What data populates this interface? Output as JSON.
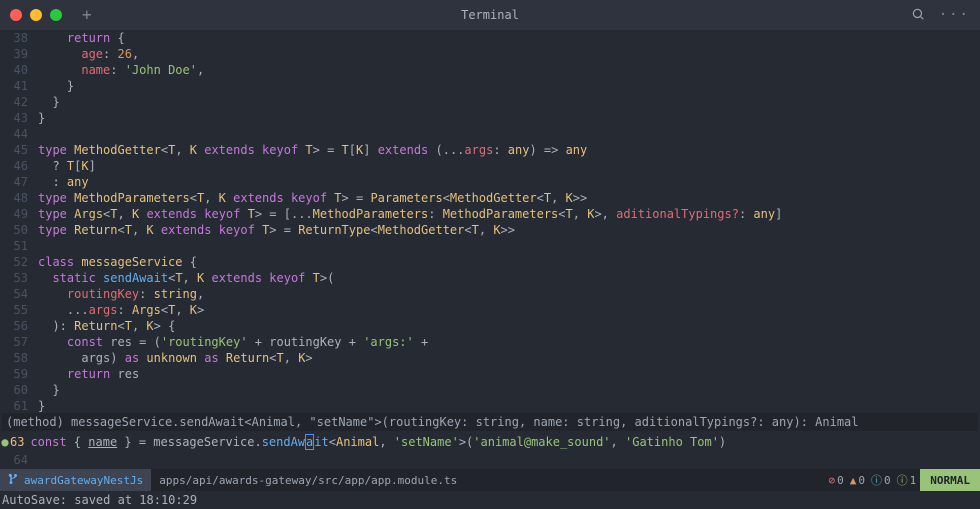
{
  "titlebar": {
    "title": "Terminal"
  },
  "code": {
    "lines": [
      {
        "n": 38,
        "i": 2,
        "t": [
          {
            "c": "kw",
            "s": "return"
          },
          {
            "c": "punc",
            "s": " {"
          }
        ]
      },
      {
        "n": 39,
        "i": 3,
        "t": [
          {
            "c": "prop",
            "s": "age"
          },
          {
            "c": "punc",
            "s": ": "
          },
          {
            "c": "num",
            "s": "26"
          },
          {
            "c": "punc",
            "s": ","
          }
        ]
      },
      {
        "n": 40,
        "i": 3,
        "t": [
          {
            "c": "prop",
            "s": "name"
          },
          {
            "c": "punc",
            "s": ": "
          },
          {
            "c": "str",
            "s": "'John Doe'"
          },
          {
            "c": "punc",
            "s": ","
          }
        ]
      },
      {
        "n": 41,
        "i": 2,
        "t": [
          {
            "c": "punc",
            "s": "}"
          }
        ]
      },
      {
        "n": 42,
        "i": 1,
        "t": [
          {
            "c": "punc",
            "s": "}"
          }
        ]
      },
      {
        "n": 43,
        "i": 0,
        "t": [
          {
            "c": "punc",
            "s": "}"
          }
        ]
      },
      {
        "n": 44,
        "i": 0,
        "t": []
      },
      {
        "n": 45,
        "i": 0,
        "t": [
          {
            "c": "kw",
            "s": "type"
          },
          {
            "c": "punc",
            "s": " "
          },
          {
            "c": "type",
            "s": "MethodGetter"
          },
          {
            "c": "punc",
            "s": "<"
          },
          {
            "c": "type",
            "s": "T"
          },
          {
            "c": "punc",
            "s": ", "
          },
          {
            "c": "type",
            "s": "K"
          },
          {
            "c": "punc",
            "s": " "
          },
          {
            "c": "kw",
            "s": "extends"
          },
          {
            "c": "punc",
            "s": " "
          },
          {
            "c": "kw",
            "s": "keyof"
          },
          {
            "c": "punc",
            "s": " "
          },
          {
            "c": "type",
            "s": "T"
          },
          {
            "c": "punc",
            "s": "> = "
          },
          {
            "c": "type",
            "s": "T"
          },
          {
            "c": "punc",
            "s": "["
          },
          {
            "c": "type",
            "s": "K"
          },
          {
            "c": "punc",
            "s": "] "
          },
          {
            "c": "kw",
            "s": "extends"
          },
          {
            "c": "punc",
            "s": " (..."
          },
          {
            "c": "param",
            "s": "args"
          },
          {
            "c": "punc",
            "s": ": "
          },
          {
            "c": "type",
            "s": "any"
          },
          {
            "c": "punc",
            "s": ") => "
          },
          {
            "c": "type",
            "s": "any"
          }
        ]
      },
      {
        "n": 46,
        "i": 1,
        "t": [
          {
            "c": "punc",
            "s": "? "
          },
          {
            "c": "type",
            "s": "T"
          },
          {
            "c": "punc",
            "s": "["
          },
          {
            "c": "type",
            "s": "K"
          },
          {
            "c": "punc",
            "s": "]"
          }
        ]
      },
      {
        "n": 47,
        "i": 1,
        "t": [
          {
            "c": "punc",
            "s": ": "
          },
          {
            "c": "type",
            "s": "any"
          }
        ]
      },
      {
        "n": 48,
        "i": 0,
        "t": [
          {
            "c": "kw",
            "s": "type"
          },
          {
            "c": "punc",
            "s": " "
          },
          {
            "c": "type",
            "s": "MethodParameters"
          },
          {
            "c": "punc",
            "s": "<"
          },
          {
            "c": "type",
            "s": "T"
          },
          {
            "c": "punc",
            "s": ", "
          },
          {
            "c": "type",
            "s": "K"
          },
          {
            "c": "punc",
            "s": " "
          },
          {
            "c": "kw",
            "s": "extends"
          },
          {
            "c": "punc",
            "s": " "
          },
          {
            "c": "kw",
            "s": "keyof"
          },
          {
            "c": "punc",
            "s": " "
          },
          {
            "c": "type",
            "s": "T"
          },
          {
            "c": "punc",
            "s": "> = "
          },
          {
            "c": "type",
            "s": "Parameters"
          },
          {
            "c": "punc",
            "s": "<"
          },
          {
            "c": "type",
            "s": "MethodGetter"
          },
          {
            "c": "punc",
            "s": "<"
          },
          {
            "c": "type",
            "s": "T"
          },
          {
            "c": "punc",
            "s": ", "
          },
          {
            "c": "type",
            "s": "K"
          },
          {
            "c": "punc",
            "s": ">>"
          }
        ]
      },
      {
        "n": 49,
        "i": 0,
        "t": [
          {
            "c": "kw",
            "s": "type"
          },
          {
            "c": "punc",
            "s": " "
          },
          {
            "c": "type",
            "s": "Args"
          },
          {
            "c": "punc",
            "s": "<"
          },
          {
            "c": "type",
            "s": "T"
          },
          {
            "c": "punc",
            "s": ", "
          },
          {
            "c": "type",
            "s": "K"
          },
          {
            "c": "punc",
            "s": " "
          },
          {
            "c": "kw",
            "s": "extends"
          },
          {
            "c": "punc",
            "s": " "
          },
          {
            "c": "kw",
            "s": "keyof"
          },
          {
            "c": "punc",
            "s": " "
          },
          {
            "c": "type",
            "s": "T"
          },
          {
            "c": "punc",
            "s": "> = [..."
          },
          {
            "c": "type",
            "s": "MethodParameters"
          },
          {
            "c": "punc",
            "s": ": "
          },
          {
            "c": "type",
            "s": "MethodParameters"
          },
          {
            "c": "punc",
            "s": "<"
          },
          {
            "c": "type",
            "s": "T"
          },
          {
            "c": "punc",
            "s": ", "
          },
          {
            "c": "type",
            "s": "K"
          },
          {
            "c": "punc",
            "s": ">, "
          },
          {
            "c": "param",
            "s": "aditionalTypings?"
          },
          {
            "c": "punc",
            "s": ": "
          },
          {
            "c": "type",
            "s": "any"
          },
          {
            "c": "punc",
            "s": "]"
          }
        ]
      },
      {
        "n": 50,
        "i": 0,
        "t": [
          {
            "c": "kw",
            "s": "type"
          },
          {
            "c": "punc",
            "s": " "
          },
          {
            "c": "type",
            "s": "Return"
          },
          {
            "c": "punc",
            "s": "<"
          },
          {
            "c": "type",
            "s": "T"
          },
          {
            "c": "punc",
            "s": ", "
          },
          {
            "c": "type",
            "s": "K"
          },
          {
            "c": "punc",
            "s": " "
          },
          {
            "c": "kw",
            "s": "extends"
          },
          {
            "c": "punc",
            "s": " "
          },
          {
            "c": "kw",
            "s": "keyof"
          },
          {
            "c": "punc",
            "s": " "
          },
          {
            "c": "type",
            "s": "T"
          },
          {
            "c": "punc",
            "s": "> = "
          },
          {
            "c": "type",
            "s": "ReturnType"
          },
          {
            "c": "punc",
            "s": "<"
          },
          {
            "c": "type",
            "s": "MethodGetter"
          },
          {
            "c": "punc",
            "s": "<"
          },
          {
            "c": "type",
            "s": "T"
          },
          {
            "c": "punc",
            "s": ", "
          },
          {
            "c": "type",
            "s": "K"
          },
          {
            "c": "punc",
            "s": ">>"
          }
        ]
      },
      {
        "n": 51,
        "i": 0,
        "t": []
      },
      {
        "n": 52,
        "i": 0,
        "t": [
          {
            "c": "kw",
            "s": "class"
          },
          {
            "c": "punc",
            "s": " "
          },
          {
            "c": "type",
            "s": "messageService"
          },
          {
            "c": "punc",
            "s": " {"
          }
        ]
      },
      {
        "n": 53,
        "i": 1,
        "t": [
          {
            "c": "kw",
            "s": "static"
          },
          {
            "c": "punc",
            "s": " "
          },
          {
            "c": "fn",
            "s": "sendAwait"
          },
          {
            "c": "punc",
            "s": "<"
          },
          {
            "c": "type",
            "s": "T"
          },
          {
            "c": "punc",
            "s": ", "
          },
          {
            "c": "type",
            "s": "K"
          },
          {
            "c": "punc",
            "s": " "
          },
          {
            "c": "kw",
            "s": "extends"
          },
          {
            "c": "punc",
            "s": " "
          },
          {
            "c": "kw",
            "s": "keyof"
          },
          {
            "c": "punc",
            "s": " "
          },
          {
            "c": "type",
            "s": "T"
          },
          {
            "c": "punc",
            "s": ">("
          }
        ]
      },
      {
        "n": 54,
        "i": 2,
        "t": [
          {
            "c": "param",
            "s": "routingKey"
          },
          {
            "c": "punc",
            "s": ": "
          },
          {
            "c": "type",
            "s": "string"
          },
          {
            "c": "punc",
            "s": ","
          }
        ]
      },
      {
        "n": 55,
        "i": 2,
        "t": [
          {
            "c": "punc",
            "s": "..."
          },
          {
            "c": "param",
            "s": "args"
          },
          {
            "c": "punc",
            "s": ": "
          },
          {
            "c": "type",
            "s": "Args"
          },
          {
            "c": "punc",
            "s": "<"
          },
          {
            "c": "type",
            "s": "T"
          },
          {
            "c": "punc",
            "s": ", "
          },
          {
            "c": "type",
            "s": "K"
          },
          {
            "c": "punc",
            "s": ">"
          }
        ]
      },
      {
        "n": 56,
        "i": 1,
        "t": [
          {
            "c": "punc",
            "s": "): "
          },
          {
            "c": "type",
            "s": "Return"
          },
          {
            "c": "punc",
            "s": "<"
          },
          {
            "c": "type",
            "s": "T"
          },
          {
            "c": "punc",
            "s": ", "
          },
          {
            "c": "type",
            "s": "K"
          },
          {
            "c": "punc",
            "s": "> {"
          }
        ]
      },
      {
        "n": 57,
        "i": 2,
        "t": [
          {
            "c": "kw",
            "s": "const"
          },
          {
            "c": "punc",
            "s": " "
          },
          {
            "c": "var",
            "s": "res"
          },
          {
            "c": "punc",
            "s": " = ("
          },
          {
            "c": "str",
            "s": "'routingKey'"
          },
          {
            "c": "punc",
            "s": " + "
          },
          {
            "c": "var",
            "s": "routingKey"
          },
          {
            "c": "punc",
            "s": " + "
          },
          {
            "c": "str",
            "s": "'args:'"
          },
          {
            "c": "punc",
            "s": " +"
          }
        ]
      },
      {
        "n": 58,
        "i": 3,
        "t": [
          {
            "c": "var",
            "s": "args"
          },
          {
            "c": "punc",
            "s": ") "
          },
          {
            "c": "kw",
            "s": "as"
          },
          {
            "c": "punc",
            "s": " "
          },
          {
            "c": "type",
            "s": "unknown"
          },
          {
            "c": "punc",
            "s": " "
          },
          {
            "c": "kw",
            "s": "as"
          },
          {
            "c": "punc",
            "s": " "
          },
          {
            "c": "type",
            "s": "Return"
          },
          {
            "c": "punc",
            "s": "<"
          },
          {
            "c": "type",
            "s": "T"
          },
          {
            "c": "punc",
            "s": ", "
          },
          {
            "c": "type",
            "s": "K"
          },
          {
            "c": "punc",
            "s": ">"
          }
        ]
      },
      {
        "n": 59,
        "i": 2,
        "t": [
          {
            "c": "kw",
            "s": "return"
          },
          {
            "c": "punc",
            "s": " "
          },
          {
            "c": "var",
            "s": "res"
          }
        ]
      },
      {
        "n": 60,
        "i": 1,
        "t": [
          {
            "c": "punc",
            "s": "}"
          }
        ]
      },
      {
        "n": 61,
        "i": 0,
        "t": [
          {
            "c": "punc",
            "s": "}"
          }
        ]
      }
    ]
  },
  "signature": "(method) messageService.sendAwait<Animal, \"setName\">(routingKey: string, name: string, aditionalTypings?: any): Animal",
  "currentLine": {
    "bullet": "●",
    "num": "63",
    "tokens": [
      {
        "c": "kw",
        "s": "const"
      },
      {
        "c": "punc",
        "s": " { "
      },
      {
        "c": "var underline",
        "s": "name"
      },
      {
        "c": "punc",
        "s": " } = "
      },
      {
        "c": "var",
        "s": "messageService"
      },
      {
        "c": "punc",
        "s": "."
      },
      {
        "c": "fn",
        "s": "sendAw"
      },
      {
        "c": "fn cursor-box",
        "s": "a"
      },
      {
        "c": "fn",
        "s": "it"
      },
      {
        "c": "punc",
        "s": "<"
      },
      {
        "c": "type",
        "s": "Animal"
      },
      {
        "c": "punc",
        "s": ", "
      },
      {
        "c": "str",
        "s": "'setName'"
      },
      {
        "c": "punc",
        "s": ">("
      },
      {
        "c": "str",
        "s": "'animal@make_sound'"
      },
      {
        "c": "punc",
        "s": ", "
      },
      {
        "c": "str",
        "s": "'Gatinho Tom'"
      },
      {
        "c": "punc",
        "s": ")"
      }
    ]
  },
  "status": {
    "branch": "awardGatewayNestJs",
    "filepath": "apps/api/awards-gateway/src/app/app.module.ts",
    "diags": {
      "err": "0",
      "warn": "0",
      "info": "0",
      "hint": "1"
    },
    "mode": "NORMAL"
  },
  "cmdline": "AutoSave: saved at 18:10:29",
  "line64": "64"
}
